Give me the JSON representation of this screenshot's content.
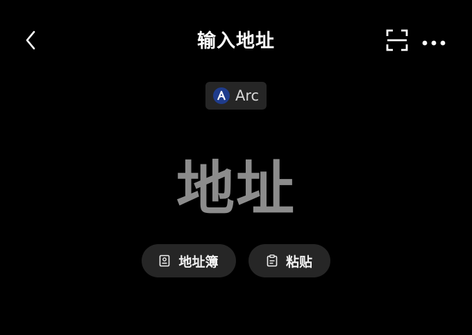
{
  "header": {
    "title": "输入地址",
    "back_icon": "chevron-left-icon",
    "scan_icon": "scan-icon",
    "more_icon": "more-horizontal-icon"
  },
  "network": {
    "name": "Arc",
    "logo_icon": "arc-logo-icon",
    "logo_color": "#1f3c8c"
  },
  "address_input": {
    "placeholder": "地址"
  },
  "actions": {
    "address_book_label": "地址簿",
    "address_book_icon": "address-book-icon",
    "paste_label": "粘贴",
    "paste_icon": "clipboard-icon"
  },
  "colors": {
    "background": "#000000",
    "chip_background": "#262626",
    "placeholder_text": "#8c8c8c"
  }
}
